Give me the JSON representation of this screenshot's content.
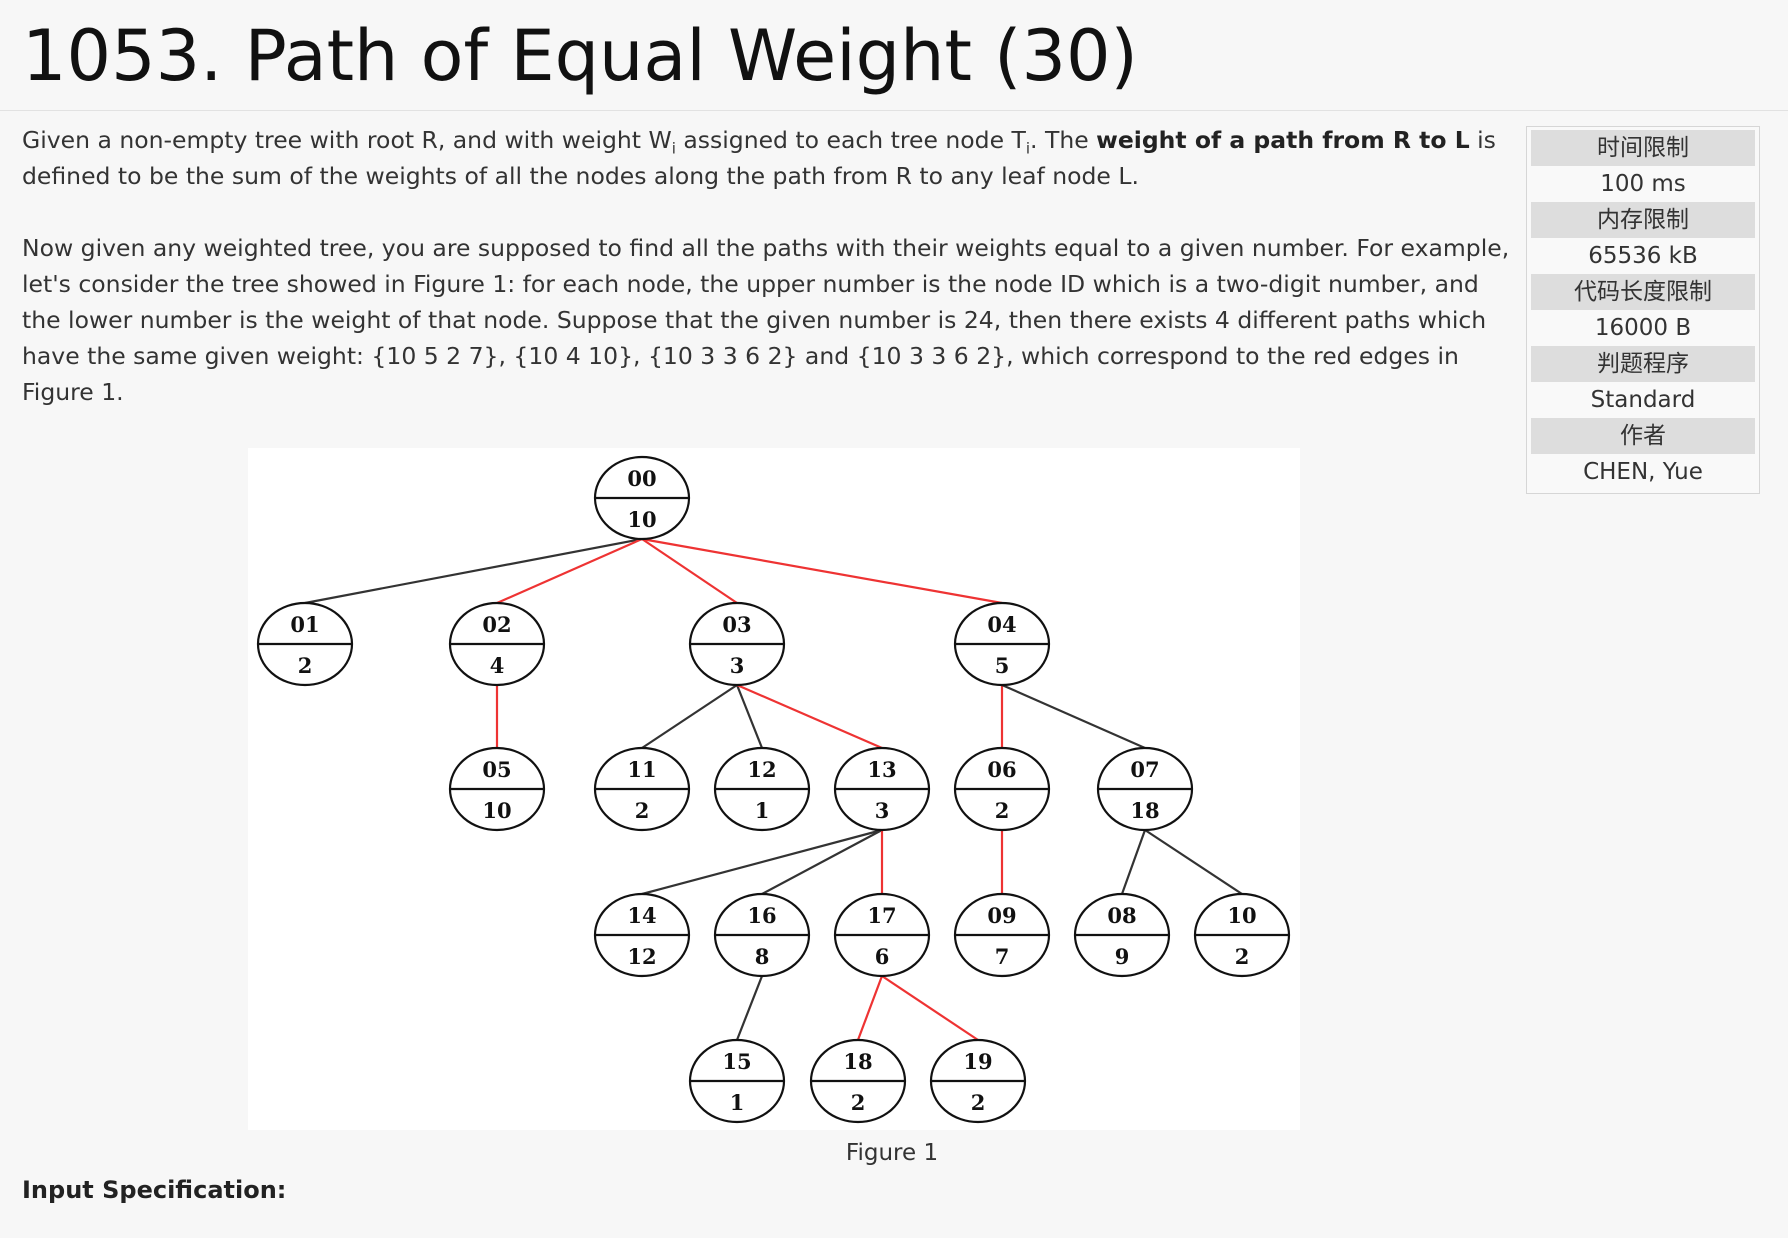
{
  "problem": {
    "title": "1053. Path of Equal Weight (30)",
    "p1": {
      "t1": "Given a non-empty tree with root R, and with weight W",
      "s1": "i",
      "t2": " assigned to each tree node T",
      "s2": "i",
      "t3": ". The ",
      "bold": "weight of a path from R to L",
      "t4": " is defined to be the sum of the weights of all the nodes along the path from R to any leaf node L."
    },
    "p2": "Now given any weighted tree, you are supposed to find all the paths with their weights equal to a given number. For example, let's consider the tree showed in Figure 1: for each node, the upper number is the node ID which is a two-digit number, and the lower number is the weight of that node. Suppose that the given number is 24, then there exists 4 different paths which have the same given weight: {10 5 2 7}, {10 4 10}, {10 3 3 6 2} and {10 3 3 6 2}, which correspond to the red edges in Figure 1.",
    "figure_caption": "Figure 1",
    "input_heading": "Input Specification:"
  },
  "info": {
    "time_label": "时间限制",
    "time_value": "100 ms",
    "memory_label": "内存限制",
    "memory_value": "65536 kB",
    "code_label": "代码长度限制",
    "code_value": "16000 B",
    "judge_label": "判题程序",
    "judge_value": "Standard",
    "author_label": "作者",
    "author_value": "CHEN, Yue"
  },
  "figure": {
    "nodes": [
      {
        "id": "00",
        "weight": "10"
      },
      {
        "id": "01",
        "weight": "2"
      },
      {
        "id": "02",
        "weight": "4"
      },
      {
        "id": "03",
        "weight": "3"
      },
      {
        "id": "04",
        "weight": "5"
      },
      {
        "id": "05",
        "weight": "10"
      },
      {
        "id": "11",
        "weight": "2"
      },
      {
        "id": "12",
        "weight": "1"
      },
      {
        "id": "13",
        "weight": "3"
      },
      {
        "id": "06",
        "weight": "2"
      },
      {
        "id": "07",
        "weight": "18"
      },
      {
        "id": "14",
        "weight": "12"
      },
      {
        "id": "16",
        "weight": "8"
      },
      {
        "id": "17",
        "weight": "6"
      },
      {
        "id": "09",
        "weight": "7"
      },
      {
        "id": "08",
        "weight": "9"
      },
      {
        "id": "10",
        "weight": "2"
      },
      {
        "id": "15",
        "weight": "1"
      },
      {
        "id": "18",
        "weight": "2"
      },
      {
        "id": "19",
        "weight": "2"
      }
    ],
    "edges": [
      {
        "from": "00",
        "to": "01",
        "highlight": false
      },
      {
        "from": "00",
        "to": "02",
        "highlight": true
      },
      {
        "from": "00",
        "to": "03",
        "highlight": true
      },
      {
        "from": "00",
        "to": "04",
        "highlight": true
      },
      {
        "from": "02",
        "to": "05",
        "highlight": true
      },
      {
        "from": "03",
        "to": "11",
        "highlight": false
      },
      {
        "from": "03",
        "to": "12",
        "highlight": false
      },
      {
        "from": "03",
        "to": "13",
        "highlight": true
      },
      {
        "from": "04",
        "to": "06",
        "highlight": true
      },
      {
        "from": "04",
        "to": "07",
        "highlight": false
      },
      {
        "from": "13",
        "to": "14",
        "highlight": false
      },
      {
        "from": "13",
        "to": "16",
        "highlight": false
      },
      {
        "from": "13",
        "to": "17",
        "highlight": true
      },
      {
        "from": "06",
        "to": "09",
        "highlight": true
      },
      {
        "from": "07",
        "to": "08",
        "highlight": false
      },
      {
        "from": "07",
        "to": "10",
        "highlight": false
      },
      {
        "from": "16",
        "to": "15",
        "highlight": false
      },
      {
        "from": "17",
        "to": "18",
        "highlight": true
      },
      {
        "from": "17",
        "to": "19",
        "highlight": true
      }
    ],
    "edge_color": "#333333",
    "highlight_color": "#ee3333"
  }
}
